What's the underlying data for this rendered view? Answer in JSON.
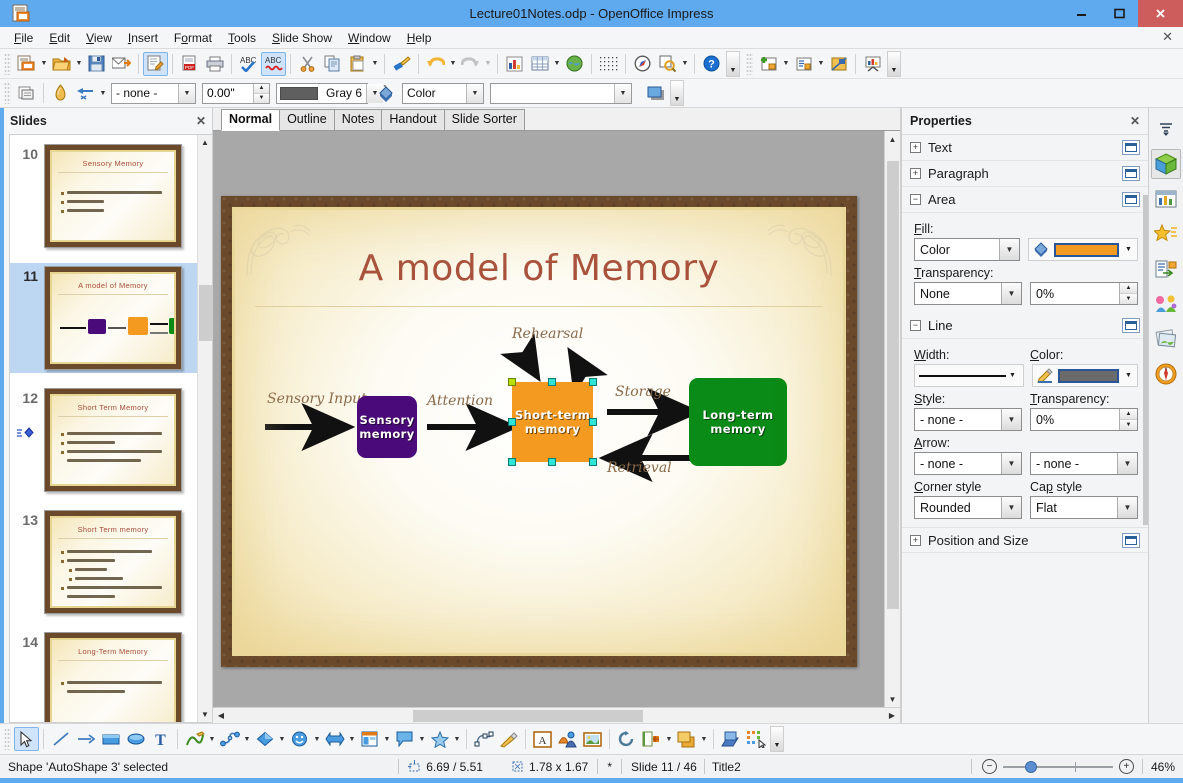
{
  "window": {
    "title": "Lecture01Notes.odp - OpenOffice Impress",
    "app_icon": "impress-doc-icon",
    "minimize": "minimize-icon",
    "maximize": "maximize-icon",
    "close": "close-icon"
  },
  "menu": {
    "items": [
      "File",
      "Edit",
      "View",
      "Insert",
      "Format",
      "Tools",
      "Slide Show",
      "Window",
      "Help"
    ],
    "close_label": "✕"
  },
  "toolbar_main": {
    "items": [
      {
        "name": "new-document-icon",
        "dropdown": true
      },
      {
        "name": "open-document-icon",
        "dropdown": true
      },
      {
        "name": "save-icon",
        "dropdown": false
      },
      {
        "name": "email-document-icon",
        "dropdown": false
      },
      {
        "sep": true
      },
      {
        "name": "edit-file-icon",
        "dropdown": false,
        "active": true
      },
      {
        "sep": true
      },
      {
        "name": "export-pdf-icon",
        "dropdown": false
      },
      {
        "name": "print-icon",
        "dropdown": false
      },
      {
        "sep": true
      },
      {
        "name": "spelling-icon",
        "dropdown": false
      },
      {
        "name": "autospellcheck-icon",
        "dropdown": false,
        "active": true
      },
      {
        "sep": true
      },
      {
        "name": "cut-icon",
        "dropdown": false
      },
      {
        "name": "copy-icon",
        "dropdown": false
      },
      {
        "name": "paste-icon",
        "dropdown": true
      },
      {
        "sep": true
      },
      {
        "name": "clone-formatting-icon",
        "dropdown": false
      },
      {
        "sep": true
      },
      {
        "name": "undo-icon",
        "dropdown": true
      },
      {
        "name": "redo-icon",
        "dropdown": true,
        "disabled": true
      },
      {
        "sep": true
      },
      {
        "name": "insert-chart-icon",
        "dropdown": false
      },
      {
        "name": "insert-table-icon",
        "dropdown": true
      },
      {
        "name": "insert-image-icon",
        "dropdown": false
      },
      {
        "sep": true
      },
      {
        "name": "display-grid-icon",
        "dropdown": false
      },
      {
        "sep": true
      },
      {
        "name": "hyperlink-icon",
        "dropdown": false
      },
      {
        "name": "zoom-icon",
        "dropdown": true
      },
      {
        "sep": true
      },
      {
        "name": "help-icon",
        "dropdown": false
      }
    ],
    "overflow": "toolbar-overflow-icon",
    "group2": [
      {
        "name": "new-slide-icon",
        "dropdown": true
      },
      {
        "name": "slide-layout-icon",
        "dropdown": true
      },
      {
        "name": "master-slide-icon",
        "dropdown": false
      },
      {
        "sep": true
      },
      {
        "name": "start-slideshow-icon",
        "dropdown": false
      }
    ]
  },
  "toolbar_line_fill": {
    "items_left": [
      {
        "name": "display-views-icon"
      },
      {
        "sep": true
      },
      {
        "name": "line-color-pen-icon"
      },
      {
        "name": "arrow-style-icon",
        "dropdown": true
      }
    ],
    "arrow_style": {
      "label": "- none -",
      "name": "arrow-style-combo"
    },
    "line_width": {
      "value": "0.00\"",
      "name": "line-width-spinner"
    },
    "line_color": {
      "label": "Gray 6",
      "swatch": "#5f5f5f",
      "name": "line-color-combo"
    },
    "fill_icon": "fill-bucket-icon",
    "fill_type": {
      "value": "Color",
      "name": "fill-style-combo"
    },
    "fill_color": {
      "value": "",
      "swatch": "#ffffff",
      "name": "fill-color-combo"
    },
    "shadow_icon": "shadow-icon",
    "overflow": "toolbar-overflow-icon"
  },
  "slides_panel": {
    "title": "Slides",
    "close": "✕",
    "scroll_up": "▲",
    "scroll_down": "▼",
    "slides": [
      {
        "number": "10",
        "title": "Sensory Memory",
        "selected": false,
        "type": "bullets",
        "bullets": [
          {
            "w": "w90",
            "indent": 0
          },
          {
            "w": "w35",
            "indent": 0
          },
          {
            "w": "w35",
            "indent": 0
          }
        ]
      },
      {
        "number": "11",
        "title": "A model of Memory",
        "selected": true,
        "type": "diagram"
      },
      {
        "number": "12",
        "title": "Short Term Memory",
        "selected": false,
        "type": "bullets",
        "marker": "transition-effect-marker",
        "bullets": [
          {
            "w": "w90",
            "indent": 0
          },
          {
            "w": "w45",
            "indent": 0
          },
          {
            "w": "w90",
            "indent": 0
          },
          {
            "w": "w70",
            "indent": 0,
            "cont": true
          }
        ]
      },
      {
        "number": "13",
        "title": "Short Term memory",
        "selected": false,
        "type": "bullets",
        "bullets": [
          {
            "w": "w80",
            "indent": 0
          },
          {
            "w": "w45",
            "indent": 0
          },
          {
            "w": "w30",
            "indent": 1
          },
          {
            "w": "w45",
            "indent": 1
          },
          {
            "w": "w90",
            "indent": 0
          },
          {
            "w": "w45",
            "indent": 0,
            "cont": true
          }
        ]
      },
      {
        "number": "14",
        "title": "Long-Term Memory",
        "selected": false,
        "type": "bullets",
        "bullets": [
          {
            "w": "w90",
            "indent": 0
          },
          {
            "w": "w55",
            "indent": 0,
            "cont": true
          }
        ]
      }
    ]
  },
  "view_tabs": {
    "items": [
      "Normal",
      "Outline",
      "Notes",
      "Handout",
      "Slide Sorter"
    ],
    "active": "Normal"
  },
  "slide": {
    "title": "A model of Memory",
    "boxes": [
      {
        "id": "sensory",
        "label": "Sensory\nmemory",
        "color": "#4b0a7a",
        "shape": "rounded"
      },
      {
        "id": "stm",
        "label": "Short-term\nmemory",
        "color": "#f49a20",
        "shape": "square",
        "selected": true
      },
      {
        "id": "ltm",
        "label": "Long-term\nmemory",
        "color": "#0a8a16",
        "shape": "rounded"
      }
    ],
    "labels": [
      {
        "id": "sensory-input",
        "text": "Sensory Input"
      },
      {
        "id": "attention",
        "text": "Attention"
      },
      {
        "id": "rehearsal",
        "text": "Rehearsal"
      },
      {
        "id": "storage",
        "text": "Storage"
      },
      {
        "id": "retrieval",
        "text": "Retrieval"
      }
    ]
  },
  "properties": {
    "title": "Properties",
    "close": "✕",
    "sections": [
      {
        "id": "text",
        "label": "Text",
        "expanded": false,
        "toggle": "+"
      },
      {
        "id": "paragraph",
        "label": "Paragraph",
        "expanded": false,
        "toggle": "+"
      },
      {
        "id": "area",
        "label": "Area",
        "expanded": true,
        "toggle": "−"
      },
      {
        "id": "line",
        "label": "Line",
        "expanded": true,
        "toggle": "−"
      },
      {
        "id": "position-size",
        "label": "Position and Size",
        "expanded": false,
        "toggle": "+"
      }
    ],
    "area": {
      "fill_label": "Fill:",
      "fill_style": "Color",
      "fill_color_swatch": "#f49a20",
      "fill_bucket_icon": "fill-bucket-icon",
      "transparency_label": "Transparency:",
      "transparency_type": "None",
      "transparency_value": "0%"
    },
    "line": {
      "width_label": "Width:",
      "color_label": "Color:",
      "line_color_swatch": "#6b6b6b",
      "line_pen_icon": "line-color-pen-icon",
      "style_label": "Style:",
      "style_value": "- none -",
      "transparency_label": "Transparency:",
      "transparency_value": "0%",
      "arrow_label": "Arrow:",
      "arrow_start": "- none -",
      "arrow_end": "- none -",
      "corner_label": "Corner style",
      "corner_value": "Rounded",
      "cap_label": "Cap style",
      "cap_value": "Flat"
    }
  },
  "rail": {
    "items": [
      {
        "name": "sidebar-settings-icon",
        "selected": false
      },
      {
        "name": "properties-deck-icon",
        "selected": true
      },
      {
        "name": "slide-transition-deck-icon",
        "selected": false
      },
      {
        "name": "animation-deck-icon",
        "selected": false
      },
      {
        "name": "master-slides-deck-icon",
        "selected": false
      },
      {
        "name": "styles-deck-icon",
        "selected": false
      },
      {
        "name": "gallery-deck-icon",
        "selected": false
      },
      {
        "name": "navigator-deck-icon",
        "selected": false
      }
    ]
  },
  "drawbar": {
    "items": [
      {
        "name": "select-tool-icon",
        "active": true
      },
      {
        "sep": true
      },
      {
        "name": "line-tool-icon"
      },
      {
        "name": "line-arrow-tool-icon"
      },
      {
        "name": "rectangle-tool-icon"
      },
      {
        "name": "ellipse-tool-icon"
      },
      {
        "name": "text-tool-icon"
      },
      {
        "sep": true
      },
      {
        "name": "curve-tool-icon",
        "dropdown": true
      },
      {
        "name": "connector-tool-icon",
        "dropdown": true
      },
      {
        "name": "basic-shapes-icon",
        "dropdown": true
      },
      {
        "name": "symbol-shapes-icon",
        "dropdown": true
      },
      {
        "name": "block-arrows-icon",
        "dropdown": true
      },
      {
        "name": "flowchart-shapes-icon",
        "dropdown": true
      },
      {
        "name": "callout-shapes-icon",
        "dropdown": true
      },
      {
        "name": "stars-shapes-icon",
        "dropdown": true
      },
      {
        "sep": true
      },
      {
        "name": "points-edit-icon"
      },
      {
        "name": "glue-points-icon"
      },
      {
        "sep": true
      },
      {
        "name": "insert-text-box-icon"
      },
      {
        "name": "fontwork-gallery-icon"
      },
      {
        "name": "insert-image-icon"
      },
      {
        "sep": true
      },
      {
        "name": "rotate-tool-icon"
      },
      {
        "name": "alignment-icon",
        "dropdown": true
      },
      {
        "name": "arrange-icon",
        "dropdown": true
      },
      {
        "sep": true
      },
      {
        "name": "shadow-tool-icon"
      },
      {
        "name": "interaction-icon"
      }
    ],
    "overflow": "drawbar-overflow-icon"
  },
  "statusbar": {
    "message": "Shape 'AutoShape 3' selected",
    "position_icon": "position-icon",
    "position": "6.69 / 5.51",
    "size_icon": "size-icon",
    "size": "1.78 x 1.67",
    "modified": "*",
    "slide_info": "Slide 11 / 46",
    "master": "Title2",
    "zoom_out": "−",
    "zoom_in": "+",
    "zoom_level": "46%"
  }
}
